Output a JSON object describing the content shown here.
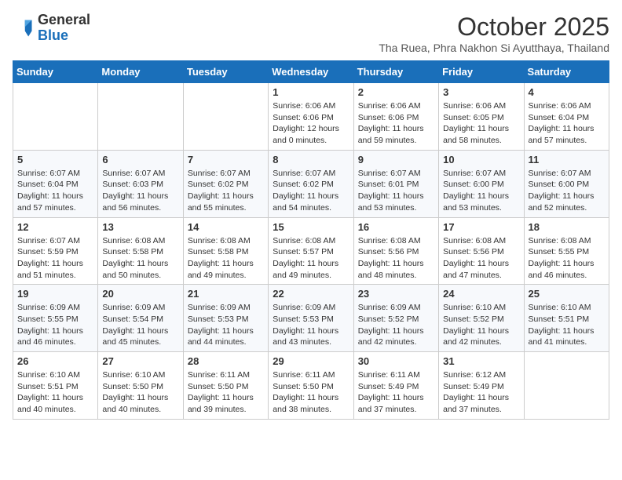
{
  "logo": {
    "general": "General",
    "blue": "Blue"
  },
  "header": {
    "month": "October 2025",
    "subtitle": "Tha Ruea, Phra Nakhon Si Ayutthaya, Thailand"
  },
  "weekdays": [
    "Sunday",
    "Monday",
    "Tuesday",
    "Wednesday",
    "Thursday",
    "Friday",
    "Saturday"
  ],
  "weeks": [
    [
      {
        "day": "",
        "info": ""
      },
      {
        "day": "",
        "info": ""
      },
      {
        "day": "",
        "info": ""
      },
      {
        "day": "1",
        "info": "Sunrise: 6:06 AM\nSunset: 6:06 PM\nDaylight: 12 hours\nand 0 minutes."
      },
      {
        "day": "2",
        "info": "Sunrise: 6:06 AM\nSunset: 6:06 PM\nDaylight: 11 hours\nand 59 minutes."
      },
      {
        "day": "3",
        "info": "Sunrise: 6:06 AM\nSunset: 6:05 PM\nDaylight: 11 hours\nand 58 minutes."
      },
      {
        "day": "4",
        "info": "Sunrise: 6:06 AM\nSunset: 6:04 PM\nDaylight: 11 hours\nand 57 minutes."
      }
    ],
    [
      {
        "day": "5",
        "info": "Sunrise: 6:07 AM\nSunset: 6:04 PM\nDaylight: 11 hours\nand 57 minutes."
      },
      {
        "day": "6",
        "info": "Sunrise: 6:07 AM\nSunset: 6:03 PM\nDaylight: 11 hours\nand 56 minutes."
      },
      {
        "day": "7",
        "info": "Sunrise: 6:07 AM\nSunset: 6:02 PM\nDaylight: 11 hours\nand 55 minutes."
      },
      {
        "day": "8",
        "info": "Sunrise: 6:07 AM\nSunset: 6:02 PM\nDaylight: 11 hours\nand 54 minutes."
      },
      {
        "day": "9",
        "info": "Sunrise: 6:07 AM\nSunset: 6:01 PM\nDaylight: 11 hours\nand 53 minutes."
      },
      {
        "day": "10",
        "info": "Sunrise: 6:07 AM\nSunset: 6:00 PM\nDaylight: 11 hours\nand 53 minutes."
      },
      {
        "day": "11",
        "info": "Sunrise: 6:07 AM\nSunset: 6:00 PM\nDaylight: 11 hours\nand 52 minutes."
      }
    ],
    [
      {
        "day": "12",
        "info": "Sunrise: 6:07 AM\nSunset: 5:59 PM\nDaylight: 11 hours\nand 51 minutes."
      },
      {
        "day": "13",
        "info": "Sunrise: 6:08 AM\nSunset: 5:58 PM\nDaylight: 11 hours\nand 50 minutes."
      },
      {
        "day": "14",
        "info": "Sunrise: 6:08 AM\nSunset: 5:58 PM\nDaylight: 11 hours\nand 49 minutes."
      },
      {
        "day": "15",
        "info": "Sunrise: 6:08 AM\nSunset: 5:57 PM\nDaylight: 11 hours\nand 49 minutes."
      },
      {
        "day": "16",
        "info": "Sunrise: 6:08 AM\nSunset: 5:56 PM\nDaylight: 11 hours\nand 48 minutes."
      },
      {
        "day": "17",
        "info": "Sunrise: 6:08 AM\nSunset: 5:56 PM\nDaylight: 11 hours\nand 47 minutes."
      },
      {
        "day": "18",
        "info": "Sunrise: 6:08 AM\nSunset: 5:55 PM\nDaylight: 11 hours\nand 46 minutes."
      }
    ],
    [
      {
        "day": "19",
        "info": "Sunrise: 6:09 AM\nSunset: 5:55 PM\nDaylight: 11 hours\nand 46 minutes."
      },
      {
        "day": "20",
        "info": "Sunrise: 6:09 AM\nSunset: 5:54 PM\nDaylight: 11 hours\nand 45 minutes."
      },
      {
        "day": "21",
        "info": "Sunrise: 6:09 AM\nSunset: 5:53 PM\nDaylight: 11 hours\nand 44 minutes."
      },
      {
        "day": "22",
        "info": "Sunrise: 6:09 AM\nSunset: 5:53 PM\nDaylight: 11 hours\nand 43 minutes."
      },
      {
        "day": "23",
        "info": "Sunrise: 6:09 AM\nSunset: 5:52 PM\nDaylight: 11 hours\nand 42 minutes."
      },
      {
        "day": "24",
        "info": "Sunrise: 6:10 AM\nSunset: 5:52 PM\nDaylight: 11 hours\nand 42 minutes."
      },
      {
        "day": "25",
        "info": "Sunrise: 6:10 AM\nSunset: 5:51 PM\nDaylight: 11 hours\nand 41 minutes."
      }
    ],
    [
      {
        "day": "26",
        "info": "Sunrise: 6:10 AM\nSunset: 5:51 PM\nDaylight: 11 hours\nand 40 minutes."
      },
      {
        "day": "27",
        "info": "Sunrise: 6:10 AM\nSunset: 5:50 PM\nDaylight: 11 hours\nand 40 minutes."
      },
      {
        "day": "28",
        "info": "Sunrise: 6:11 AM\nSunset: 5:50 PM\nDaylight: 11 hours\nand 39 minutes."
      },
      {
        "day": "29",
        "info": "Sunrise: 6:11 AM\nSunset: 5:50 PM\nDaylight: 11 hours\nand 38 minutes."
      },
      {
        "day": "30",
        "info": "Sunrise: 6:11 AM\nSunset: 5:49 PM\nDaylight: 11 hours\nand 37 minutes."
      },
      {
        "day": "31",
        "info": "Sunrise: 6:12 AM\nSunset: 5:49 PM\nDaylight: 11 hours\nand 37 minutes."
      },
      {
        "day": "",
        "info": ""
      }
    ]
  ]
}
